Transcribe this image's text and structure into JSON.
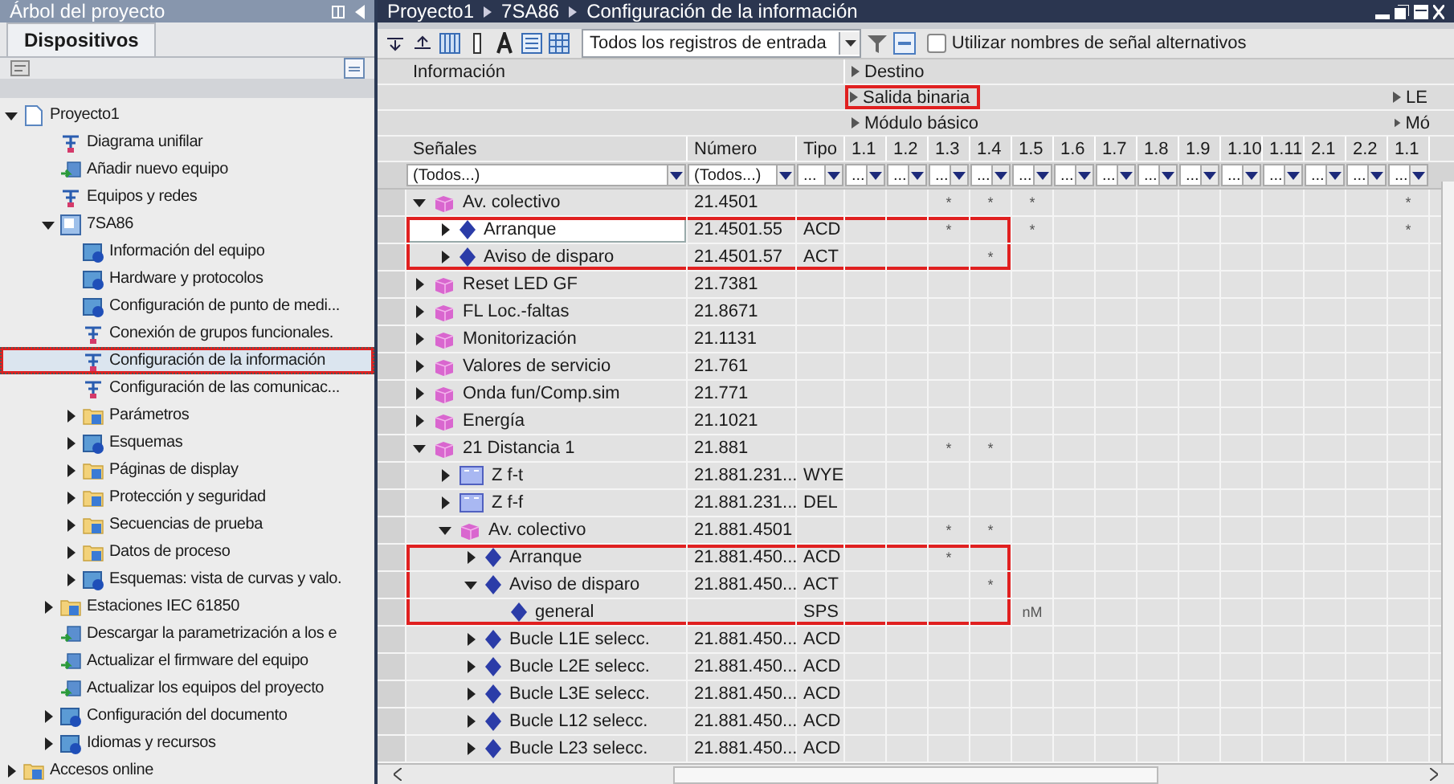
{
  "project_tree": {
    "title": "Árbol del proyecto",
    "tabs": [
      {
        "label": "Dispositivos",
        "selected": true
      }
    ],
    "items": [
      {
        "label": "Proyecto1",
        "kind": "page",
        "expanded": true,
        "selected": false,
        "children": [
          {
            "label": "Diagrama unifilar",
            "kind": "tool",
            "selected": false
          },
          {
            "label": "Añadir nuevo equipo",
            "kind": "action",
            "selected": false
          },
          {
            "label": "Equipos y redes",
            "kind": "tool",
            "selected": false
          },
          {
            "label": "7SA86",
            "kind": "device",
            "expanded": true,
            "selected": false,
            "children": [
              {
                "label": "Información del equipo",
                "kind": "editor",
                "selected": false
              },
              {
                "label": "Hardware y protocolos",
                "kind": "editor",
                "selected": false
              },
              {
                "label": "Configuración de punto de medi...",
                "kind": "editor",
                "selected": false
              },
              {
                "label": "Conexión de grupos funcionales.",
                "kind": "tool",
                "selected": false
              },
              {
                "label": "Configuración de la información",
                "kind": "tool",
                "selected": true,
                "highlighted": true
              },
              {
                "label": "Configuración de las comunicac...",
                "kind": "tool",
                "selected": false
              },
              {
                "label": "Parámetros",
                "kind": "folder",
                "expanded": false,
                "selected": false
              },
              {
                "label": "Esquemas",
                "kind": "editor",
                "expanded": false,
                "selected": false
              },
              {
                "label": "Páginas de display",
                "kind": "folder",
                "expanded": false,
                "selected": false
              },
              {
                "label": "Protección y seguridad",
                "kind": "folder",
                "expanded": false,
                "selected": false
              },
              {
                "label": "Secuencias de prueba",
                "kind": "folder",
                "expanded": false,
                "selected": false
              },
              {
                "label": "Datos de proceso",
                "kind": "folder",
                "expanded": false,
                "selected": false
              },
              {
                "label": "Esquemas: vista de curvas y valo.",
                "kind": "editor",
                "expanded": false,
                "selected": false
              }
            ]
          },
          {
            "label": "Estaciones IEC 61850",
            "kind": "folder",
            "expanded": false,
            "selected": false
          },
          {
            "label": "Descargar la parametrización a los e",
            "kind": "action",
            "selected": false
          },
          {
            "label": "Actualizar el firmware del equipo",
            "kind": "action",
            "selected": false
          },
          {
            "label": "Actualizar los equipos del proyecto",
            "kind": "action",
            "selected": false
          },
          {
            "label": "Configuración del documento",
            "kind": "editor",
            "expanded": false,
            "selected": false
          },
          {
            "label": "Idiomas y recursos",
            "kind": "editor",
            "expanded": false,
            "selected": false
          }
        ]
      },
      {
        "label": "Accesos online",
        "kind": "folder",
        "expanded": false,
        "selected": false
      }
    ]
  },
  "editor": {
    "breadcrumb": [
      "Proyecto1",
      "7SA86",
      "Configuración de la información"
    ],
    "toolbar": {
      "filter_dropdown": "Todos los registros de entrada",
      "alt_names": {
        "label": "Utilizar nombres de señal alternativos",
        "checked": false
      }
    },
    "table": {
      "info_header": "Información",
      "destination_header": "Destino",
      "groups": [
        {
          "label": "Salida binaria",
          "highlighted": true,
          "module": "Módulo básico",
          "columns": [
            "1.1",
            "1.2",
            "1.3",
            "1.4",
            "1.5",
            "1.6",
            "1.7",
            "1.8",
            "1.9",
            "1.10",
            "1.11",
            "2.1",
            "2.2"
          ]
        },
        {
          "label": "LE",
          "highlighted": false,
          "module": "Mó",
          "columns": [
            "1.1"
          ]
        }
      ],
      "columns": [
        "Señales",
        "Número",
        "Tipo"
      ],
      "filters": [
        "(Todos...)",
        "(Todos...)",
        "..."
      ],
      "destination_filters": [
        "...",
        "...",
        "...",
        "...",
        "...",
        "...",
        "...",
        "...",
        "...",
        "...",
        "...",
        "...",
        "...",
        "..."
      ],
      "rows": [
        {
          "name": "Av. colectivo",
          "number": "21.4501",
          "kind": "group",
          "expanded": true,
          "selected": false,
          "dest": {
            "2": "*",
            "3": "*",
            "4": "*",
            "13": "*"
          },
          "children": [
            {
              "name": "Arranque",
              "number": "21.4501.55",
              "type": "ACD",
              "kind": "signal",
              "expanded": false,
              "selected": true,
              "highlighted": true,
              "dest": {
                "2": "*",
                "4": "*",
                "13": "*"
              }
            },
            {
              "name": "Aviso de disparo",
              "number": "21.4501.57",
              "type": "ACT",
              "kind": "signal",
              "expanded": false,
              "selected": false,
              "highlighted": true,
              "dest": {
                "3": "*"
              }
            }
          ]
        },
        {
          "name": "Reset LED GF",
          "number": "21.7381",
          "kind": "group",
          "expanded": false,
          "selected": false
        },
        {
          "name": "FL Loc.-faltas",
          "number": "21.8671",
          "kind": "group",
          "expanded": false,
          "selected": false
        },
        {
          "name": "Monitorización",
          "number": "21.1131",
          "kind": "group",
          "expanded": false,
          "selected": false
        },
        {
          "name": "Valores de servicio",
          "number": "21.761",
          "kind": "group",
          "expanded": false,
          "selected": false
        },
        {
          "name": "Onda fun/Comp.sim",
          "number": "21.771",
          "kind": "group",
          "expanded": false,
          "selected": false
        },
        {
          "name": "Energía",
          "number": "21.1021",
          "kind": "group",
          "expanded": false,
          "selected": false
        },
        {
          "name": "21 Distancia 1",
          "number": "21.881",
          "kind": "group",
          "expanded": true,
          "selected": false,
          "dest": {
            "2": "*",
            "3": "*"
          },
          "children": [
            {
              "name": "Z f-t",
              "number": "21.881.231...",
              "type": "WYE",
              "kind": "measurement",
              "expanded": false,
              "selected": false
            },
            {
              "name": "Z f-f",
              "number": "21.881.231...",
              "type": "DEL",
              "kind": "measurement",
              "expanded": false,
              "selected": false
            },
            {
              "name": "Av. colectivo",
              "number": "21.881.4501",
              "kind": "group",
              "expanded": true,
              "selected": false,
              "dest": {
                "2": "*",
                "3": "*"
              },
              "children": [
                {
                  "name": "Arranque",
                  "number": "21.881.450...",
                  "type": "ACD",
                  "kind": "signal",
                  "expanded": false,
                  "selected": false,
                  "highlighted": true,
                  "dest": {
                    "2": "*"
                  }
                },
                {
                  "name": "Aviso de disparo",
                  "number": "21.881.450...",
                  "type": "ACT",
                  "kind": "signal",
                  "expanded": true,
                  "selected": false,
                  "highlighted": true,
                  "dest": {
                    "3": "*"
                  },
                  "children": [
                    {
                      "name": "general",
                      "type": "SPS",
                      "kind": "signal",
                      "selected": false,
                      "highlighted": true,
                      "dest": {
                        "4": "nM"
                      }
                    }
                  ]
                },
                {
                  "name": "Bucle L1E  selecc.",
                  "number": "21.881.450...",
                  "type": "ACD",
                  "kind": "signal",
                  "expanded": false,
                  "selected": false
                },
                {
                  "name": "Bucle L2E  selecc.",
                  "number": "21.881.450...",
                  "type": "ACD",
                  "kind": "signal",
                  "expanded": false,
                  "selected": false
                },
                {
                  "name": "Bucle L3E  selecc.",
                  "number": "21.881.450...",
                  "type": "ACD",
                  "kind": "signal",
                  "expanded": false,
                  "selected": false
                },
                {
                  "name": "Bucle L12  selecc.",
                  "number": "21.881.450...",
                  "type": "ACD",
                  "kind": "signal",
                  "expanded": false,
                  "selected": false
                },
                {
                  "name": "Bucle L23  selecc.",
                  "number": "21.881.450...",
                  "type": "ACD",
                  "kind": "signal",
                  "expanded": false,
                  "selected": false
                }
              ]
            }
          ]
        }
      ]
    }
  }
}
